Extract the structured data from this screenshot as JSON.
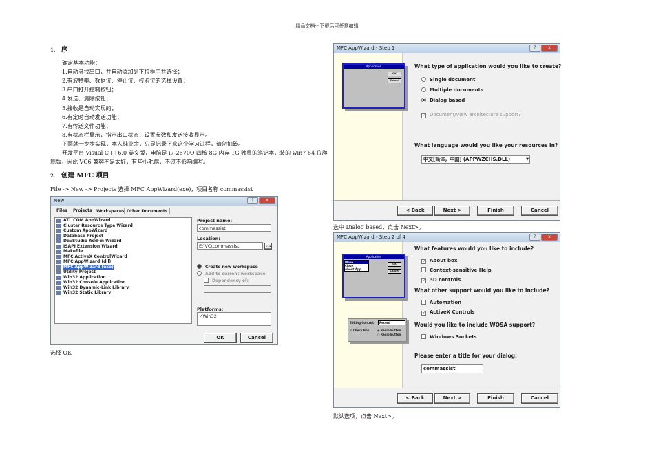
{
  "header": "精品文档---下载后可任意编辑",
  "section1": {
    "num": "1.",
    "title": "序",
    "lines": [
      "确定基本功能：",
      "1.自动寻找串口，并自动添加到下拉框中共选择；",
      "2.有波特率、数据位、停止位、校验位的选择设置；",
      "3.串口打开控制按钮；",
      "4.发送、清除按钮；",
      "5.接收是自动实现的；",
      "6.有定时自动发送功能；",
      "7.有传送文件功能；",
      "8.有状态栏显示，指示串口状态，设置参数和发送接收显示。",
      "下面就一步步实现，本人纯业余，只是记录下来这个学习过程，请勿拍砖。",
      "开发平台 Visual C++6.0 英文版，电脑是 i7-2670Q 四核 8G 内存 1G 独显的笔记本，装的 win7 64 位旗",
      "舰版，因此 VC6 兼容不是太好，有些小毛病，不过不影响编写。"
    ]
  },
  "section2": {
    "num": "2.",
    "title": "创建 MFC 项目",
    "intro": "File -> New -> Projects 选择 MFC AppWizard(exe)，项目名称 commassist",
    "caption_new": "选择 OK",
    "caption_step1": "选中 Dialog based，点击 Next>。",
    "caption_step2": "默认选项，点击 Next>。"
  },
  "new_dialog": {
    "title": "New",
    "help": "?",
    "close": "x",
    "tabs": [
      "Files",
      "Projects",
      "Workspaces",
      "Other Documents"
    ],
    "projects": [
      "ATL COM AppWizard",
      "Cluster Resource Type Wizard",
      "Custom AppWizard",
      "Database Project",
      "DevStudio Add-in Wizard",
      "ISAPI Extension Wizard",
      "Makefile",
      "MFC ActiveX ControlWizard",
      "MFC AppWizard (dll)",
      "MFC AppWizard (exe)",
      "Utility Project",
      "Win32 Application",
      "Win32 Console Application",
      "Win32 Dynamic-Link Library",
      "Win32 Static Library"
    ],
    "selected_index": 9,
    "project_name_label": "Project name:",
    "project_name": "commassist",
    "location_label": "Location:",
    "location": "E:\\VC\\commassist",
    "browse": "...",
    "create_new": "Create new workspace",
    "add_current": "Add to current workspace",
    "dependency": "Dependency of:",
    "platforms_label": "Platforms:",
    "platform": "Win32",
    "ok": "OK",
    "cancel": "Cancel"
  },
  "step1": {
    "title": "MFC AppWizard - Step 1",
    "preview_title": "Application",
    "preview_ok": "OK",
    "preview_cancel": "Cancel",
    "question": "What type of application would you like to create?",
    "options": [
      "Single document",
      "Multiple documents",
      "Dialog based"
    ],
    "selected": 2,
    "docview": "Document/View architecture support?",
    "lang_question": "What language would you like your resources in?",
    "language": "中文[简体，中国] (APPWZCHS.DLL)",
    "back": "< Back",
    "next": "Next >",
    "finish": "Finish",
    "cancel": "Cancel"
  },
  "step2": {
    "title": "MFC AppWizard - Step 2 of 4",
    "preview_title": "Application",
    "preview_menu": [
      "Move",
      "Close",
      "About App..."
    ],
    "preview_ok": "OK",
    "preview_cancel": "Cancel",
    "edit_label": "Editing Control:",
    "edit_value": "Record",
    "check_box": "Check Box",
    "radio1": "Radio Button",
    "radio2": "Radio Button",
    "q_features": "What features would you like to include?",
    "features": [
      {
        "label": "About box",
        "checked": true
      },
      {
        "label": "Context-sensitive Help",
        "checked": false
      },
      {
        "label": "3D controls",
        "checked": true
      }
    ],
    "q_support": "What other support would you like to include?",
    "support": [
      {
        "label": "Automation",
        "checked": false
      },
      {
        "label": "ActiveX Controls",
        "checked": true
      }
    ],
    "q_wosa": "Would you like to include WOSA support?",
    "wosa": [
      {
        "label": "Windows Sockets",
        "checked": false
      }
    ],
    "q_title": "Please enter a title for your dialog:",
    "dialog_title": "commassist",
    "back": "< Back",
    "next": "Next >",
    "finish": "Finish",
    "cancel": "Cancel"
  }
}
